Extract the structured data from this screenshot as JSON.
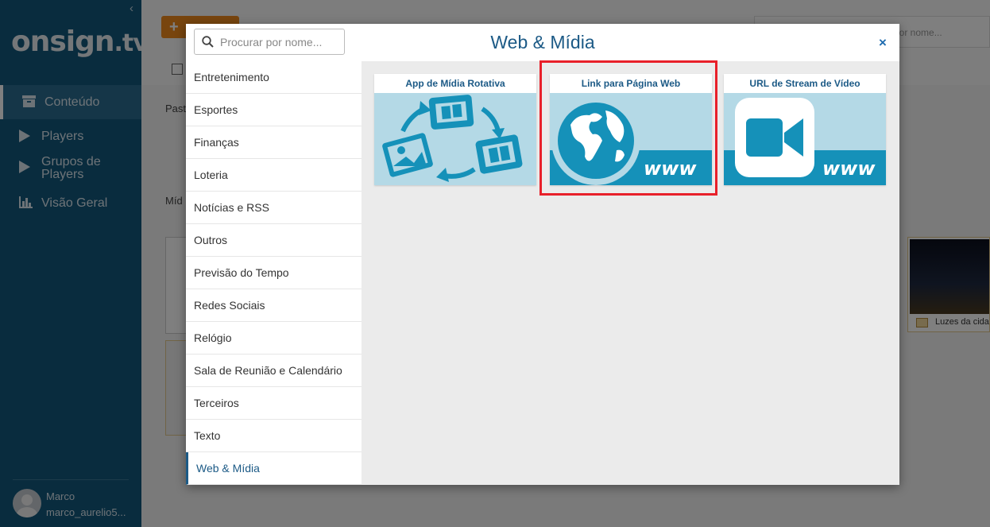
{
  "sidebar": {
    "logo_main": "onsign",
    "logo_tld": ".tv",
    "collapse_glyph": "‹",
    "items": [
      {
        "label": "Conteúdo",
        "icon": "archive-icon",
        "active": true
      },
      {
        "label": "Players",
        "icon": "play-icon",
        "active": false
      },
      {
        "label": "Grupos de Players",
        "icon": "play-icon",
        "active": false
      },
      {
        "label": "Visão Geral",
        "icon": "bar-chart-icon",
        "active": false
      }
    ],
    "user": {
      "name": "Marco",
      "email": "marco_aurelio5..."
    }
  },
  "background": {
    "add_button": "+",
    "search_placeholder": "por nome...",
    "label_pasta": "Past",
    "label_midia": "Míd",
    "card_caption": "Luzes da cida"
  },
  "modal": {
    "title": "Web & Mídia",
    "search_placeholder": "Procurar por nome...",
    "close_glyph": "×",
    "categories": [
      "Entretenimento",
      "Esportes",
      "Finanças",
      "Loteria",
      "Notícias e RSS",
      "Outros",
      "Previsão do Tempo",
      "Redes Sociais",
      "Relógio",
      "Sala de Reunião e Calendário",
      "Terceiros",
      "Texto",
      "Web & Mídia"
    ],
    "active_category": "Web & Mídia",
    "tiles": [
      {
        "title": "App de Mídia Rotativa",
        "icon": "rotating-media-icon"
      },
      {
        "title": "Link para Página Web",
        "icon": "globe-www-icon",
        "badge": "www"
      },
      {
        "title": "URL de Stream de Vídeo",
        "icon": "video-camera-icon",
        "badge": "www"
      }
    ]
  },
  "colors": {
    "sidebar": "#13587c",
    "accent": "#1c5a86",
    "tile_bg": "#b4d9e6",
    "tile_icon": "#1591b9",
    "highlight": "#e8202a"
  }
}
